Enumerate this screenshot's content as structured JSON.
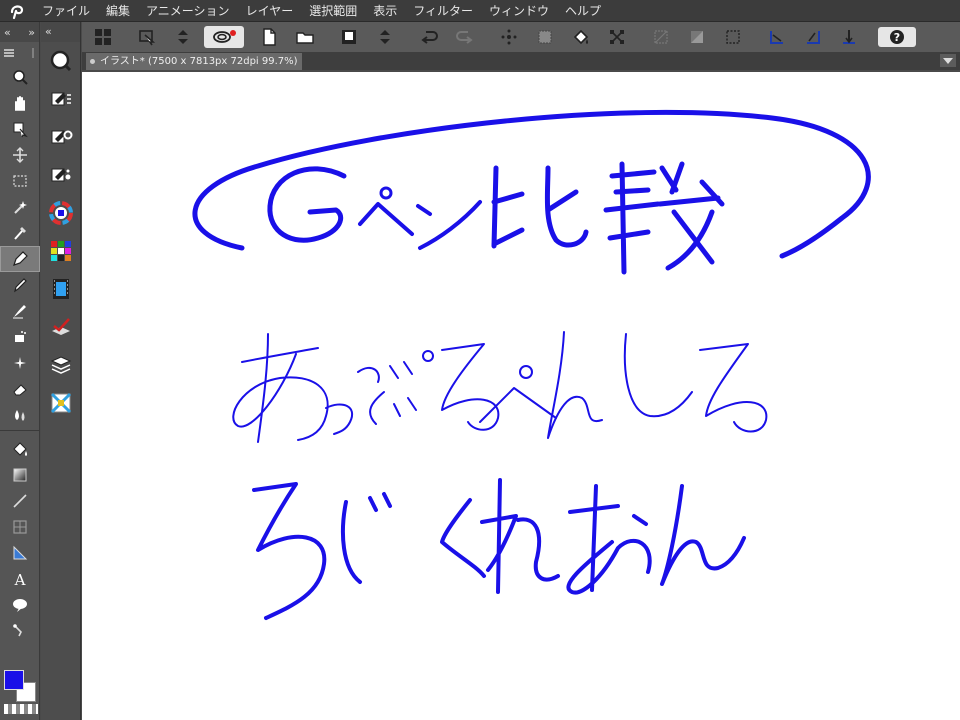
{
  "menu": {
    "items": [
      "ファイル",
      "編集",
      "アニメーション",
      "レイヤー",
      "選択範囲",
      "表示",
      "フィルター",
      "ウィンドウ",
      "ヘルプ"
    ]
  },
  "canvas_tab": {
    "label": "イラスト* (7500 x 7813px 72dpi 99.7%)"
  },
  "toolbar": {
    "icons": [
      "layout-icon",
      "transform-icon",
      "stepper-icon",
      "lasso-icon",
      "new-file-icon",
      "open-folder-icon",
      "save-icon",
      "undo-icon",
      "redo-icon",
      "snap-icon",
      "selection-icon",
      "fill-icon",
      "transform-crop-icon",
      "help-icon"
    ]
  },
  "colors": {
    "accent_ink": "#1a10e8",
    "main_color": "#1a10e8",
    "sub_color": "#ffffff",
    "menubar_bg": "#3c3c3c",
    "toolbar_bg": "#5a5a5a"
  },
  "canvas": {
    "handwriting_title": "Gペン比較",
    "handwriting_line2": "あっぷるぺんしる",
    "handwriting_line3": "ろじ くれおん"
  }
}
